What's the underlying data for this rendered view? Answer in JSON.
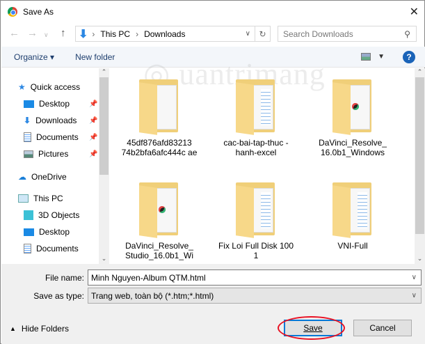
{
  "window": {
    "title": "Save As"
  },
  "address": {
    "crumbs": [
      "This PC",
      "Downloads"
    ]
  },
  "search": {
    "placeholder": "Search Downloads"
  },
  "toolbar": {
    "organize": "Organize",
    "new_folder": "New folder"
  },
  "nav": {
    "quick_access": "Quick access",
    "quick_items": [
      "Desktop",
      "Downloads",
      "Documents",
      "Pictures"
    ],
    "onedrive": "OneDrive",
    "this_pc": "This PC",
    "pc_items": [
      "3D Objects",
      "Desktop",
      "Documents"
    ]
  },
  "files": [
    {
      "name": "45df876afd83213 74b2bfa6afc444c ae",
      "kind": "doc"
    },
    {
      "name": "cac-bai-tap-thuc -hanh-excel",
      "kind": "lines"
    },
    {
      "name": "DaVinci_Resolve_ 16.0b1_Windows",
      "kind": "davinci"
    },
    {
      "name": "DaVinci_Resolve_ Studio_16.0b1_Wi",
      "kind": "davinci"
    },
    {
      "name": "Fix Loi Full Disk 100 1",
      "kind": "lines"
    },
    {
      "name": "VNI-Full",
      "kind": "lines"
    }
  ],
  "watermark": "Quantrimang",
  "form": {
    "file_name_label": "File name:",
    "file_name": "Minh Nguyen-Album QTM.html",
    "type_label": "Save as type:",
    "type": "Trang web, toàn bộ (*.htm;*.html)"
  },
  "buttons": {
    "hide_folders": "Hide Folders",
    "save": "Save",
    "cancel": "Cancel"
  },
  "colors": {
    "accent": "#0078d7",
    "highlight": "#e81123"
  }
}
